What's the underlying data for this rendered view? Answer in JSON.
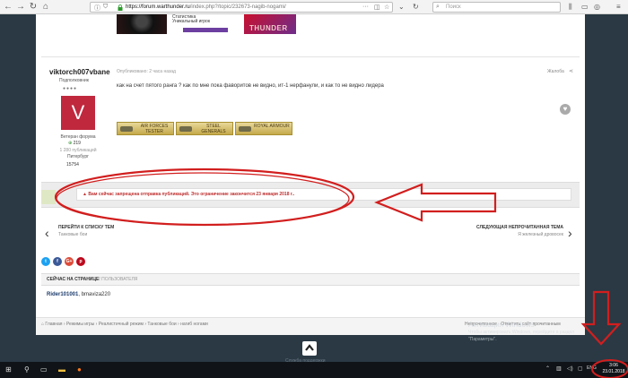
{
  "browser": {
    "url_host": "https://forum.warthunder.ru",
    "url_path": "/index.php?/topic/232673-nagib-nogami/",
    "search_placeholder": "Поиск"
  },
  "signature_banner": {
    "line1": "Статистика",
    "line2": "Уникальный игрок",
    "logo_text": "THUNDER"
  },
  "post": {
    "author_name": "viktorch007vbane",
    "author_group": "Подполковник",
    "avatar_letter": "V",
    "rank": "Ветеран форума",
    "reputation_value": "219",
    "posts_count": "1 280 публикаций",
    "city": "Питербург",
    "signature_number": "15754",
    "meta": "Опубликовано: 2 часа назад",
    "report_label": "Жалоба",
    "text": "как на счет пятого ранга ? как по мне пока фаворитов не видно, ит-1 нерфанули, и как то не видно лидера",
    "awards": [
      "AIR FORCES TESTER",
      "STEEL GENERALS",
      "ROYAL ARMOUR"
    ]
  },
  "notice": {
    "text": "Вам сейчас запрещена отправка публикаций. Это ограничение закончится 23 января 2018 г.."
  },
  "pagination": {
    "prev_title": "ПЕРЕЙТИ К СПИСКУ ТЕМ",
    "prev_sub": "Танковые бои",
    "next_title": "СЛЕДУЮЩАЯ НЕПРОЧИТАННАЯ ТЕМА",
    "next_sub": "Я железный дровосек"
  },
  "social": [
    "t",
    "f",
    "G+",
    "p"
  ],
  "online": {
    "title": "СЕЙЧАС НА СТРАНИЦЕ",
    "count": "2 ПОЛЬЗОВАТЕЛЯ",
    "user1": "Rider101001",
    "user2": "bmaviza220"
  },
  "breadcrumbs": {
    "items": [
      "Главная",
      "Режимы игры",
      "Реалистичный режим",
      "Танковые бои",
      "нагиб ногами"
    ],
    "right1": "Непрочитанное",
    "right2": "Отметить сайт прочитанным"
  },
  "watermark": {
    "line1": "Активация Windows",
    "line2": "Чтобы активировать Windows, перейдите в раздел",
    "line3": "\"Параметры\"."
  },
  "below_text": "Служба поддержки",
  "taskbar": {
    "lang": "ENG",
    "time": "3:06",
    "date": "23.01.2018"
  },
  "colors": {
    "notice_red": "#c03030",
    "annotation_red": "#d21e1e",
    "avatar": "#c0283e"
  }
}
